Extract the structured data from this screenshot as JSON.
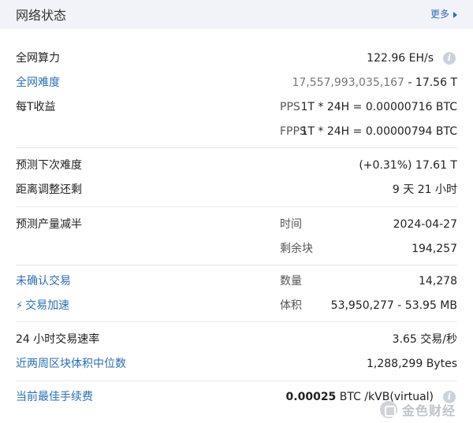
{
  "header": {
    "title": "网络状态",
    "more_label": "更多"
  },
  "hashrate": {
    "label": "全网算力",
    "value": "122.96 EH/s"
  },
  "difficulty": {
    "label": "全网难度",
    "value_full": "17,557,993,035,167",
    "value_short": "- 17.56 T"
  },
  "earnings": {
    "label": "每T收益",
    "pps_label": "PPS",
    "pps_value": "1T * 24H = 0.00000716 BTC",
    "fpps_label": "FPPS",
    "fpps_value": "1T * 24H = 0.00000794 BTC"
  },
  "next_difficulty": {
    "label": "预测下次难度",
    "value": "(+0.31%) 17.61 T"
  },
  "adjust_remaining": {
    "label": "距离调整还剩",
    "value": "9 天 21 小时"
  },
  "halving": {
    "label": "预测产量减半",
    "time_label": "时间",
    "time_value": "2024-04-27",
    "blocks_label": "剩余块",
    "blocks_value": "194,257"
  },
  "unconfirmed": {
    "label": "未确认交易",
    "count_label": "数量",
    "count_value": "14,278",
    "accelerate_label": "交易加速",
    "size_label": "体积",
    "size_value": "53,950,277 - 53.95 MB"
  },
  "tx_rate": {
    "label": "24 小时交易速率",
    "value": "3.65 交易/秒"
  },
  "median_block": {
    "label": "近两周区块体积中位数",
    "value": "1,288,299 Bytes"
  },
  "fee": {
    "label": "当前最佳手续费",
    "value_bold": "0.00025",
    "value_rest": " BTC /kVB(virtual)"
  },
  "watermark": {
    "text": "金色财经"
  },
  "icons": {
    "info": "info-icon",
    "more": "chevron-right-icon",
    "accelerate": "bolt-icon",
    "watermark": "jinse-logo-icon"
  },
  "colors": {
    "link": "#2a6ebb",
    "header_bg": "#f2f3f8",
    "divider": "#e6e8ec"
  }
}
